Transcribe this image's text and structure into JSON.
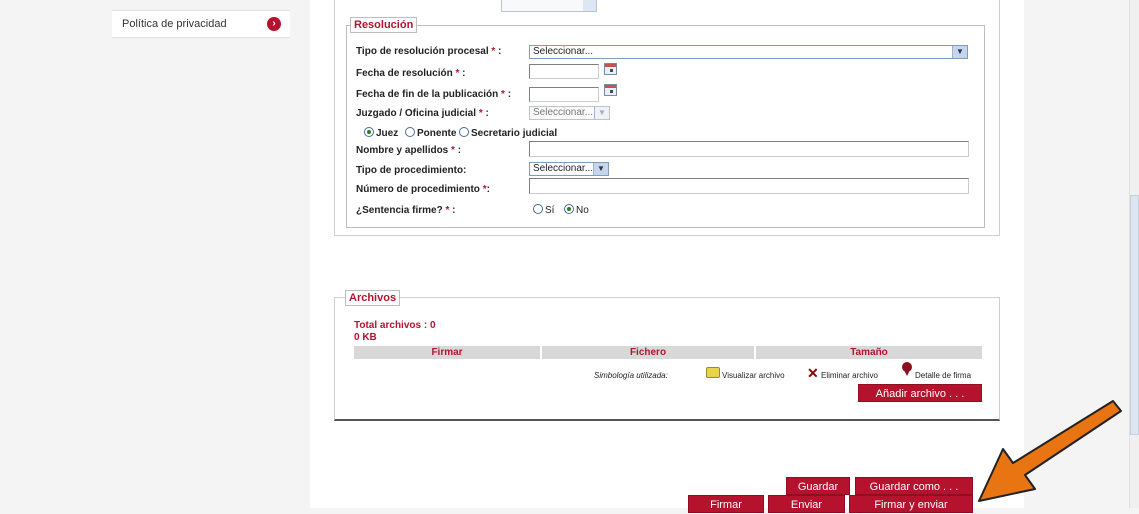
{
  "sidebar": {
    "items": [
      {
        "label": "Política de privacidad"
      }
    ]
  },
  "resolucion": {
    "legend": "Resolución",
    "required_mark": "*",
    "tipo_label": "Tipo de resolución procesal",
    "tipo_value": "Seleccionar...",
    "fecha_label": "Fecha de resolución",
    "fecha_fin_label": "Fecha de fin de la publicación",
    "juzgado_label": "Juzgado / Oficina judicial",
    "juzgado_value": "Seleccionar...",
    "radio_juez": "Juez",
    "radio_ponente": "Ponente",
    "radio_secretario": "Secretario judicial",
    "nombre_label": "Nombre y apellidos",
    "tipo_proc_label": "Tipo de procedimiento:",
    "tipo_proc_value": "Seleccionar...",
    "numero_label": "Número de procedimiento",
    "sentencia_label": "¿Sentencia firme?",
    "si": "Sí",
    "no": "No"
  },
  "archivos": {
    "legend": "Archivos",
    "total": "Total archivos : 0",
    "size": "0 KB",
    "columns": [
      "Firmar",
      "Fichero",
      "Tamaño"
    ],
    "simbologia": "Simbología utilizada:",
    "visualizar": "Visualizar archivo",
    "eliminar": "Eliminar archivo",
    "detalle": "Detalle de firma",
    "add_button": "Añadir archivo . . ."
  },
  "actions": {
    "guardar": "Guardar",
    "guardar_como": "Guardar como . . .",
    "firmar": "Firmar",
    "enviar": "Enviar",
    "firmar_enviar": "Firmar y enviar"
  },
  "colors": {
    "accent": "#b5122e",
    "annotation_arrow": "#e87511"
  }
}
